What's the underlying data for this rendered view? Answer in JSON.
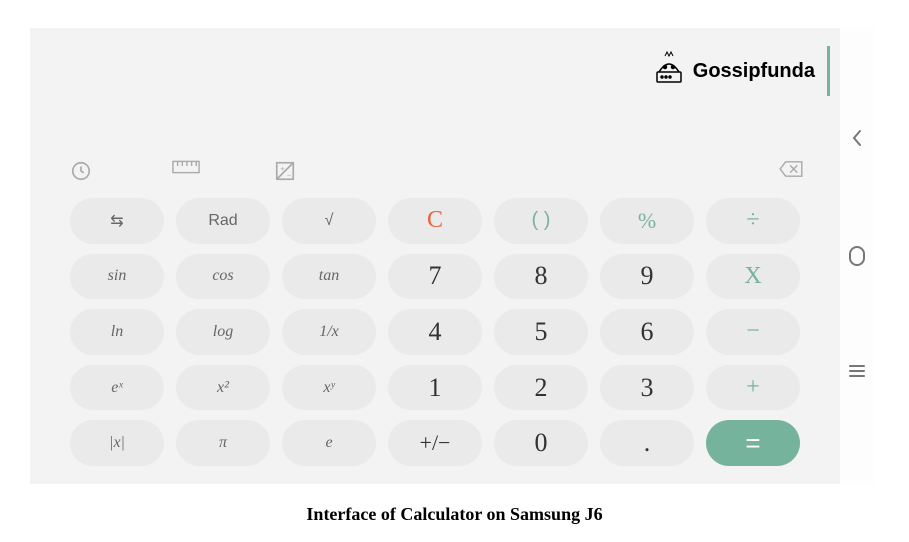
{
  "watermark": {
    "brand": "Gossipfunda"
  },
  "toolbar": {
    "history": "history",
    "ruler": "ruler",
    "plusminus": "plusminus",
    "backspace": "backspace"
  },
  "keys": {
    "swap": "⇆",
    "rad": "Rad",
    "sqrt": "√",
    "clear": "C",
    "paren": "( )",
    "percent": "%",
    "divide": "÷",
    "sin": "sin",
    "cos": "cos",
    "tan": "tan",
    "seven": "7",
    "eight": "8",
    "nine": "9",
    "multiply": "X",
    "ln": "ln",
    "log": "log",
    "inv": "1/x",
    "four": "4",
    "five": "5",
    "six": "6",
    "minus": "−",
    "ex": "eˣ",
    "x2": "x²",
    "xy": "xʸ",
    "one": "1",
    "two": "2",
    "three": "3",
    "plus": "+",
    "abs": "|x|",
    "pi": "π",
    "e": "e",
    "sign": "+/−",
    "zero": "0",
    "dot": ".",
    "equals": "="
  },
  "nav": {
    "back": "back",
    "home": "home",
    "recents": "recents"
  },
  "caption": "Interface of Calculator on Samsung J6"
}
